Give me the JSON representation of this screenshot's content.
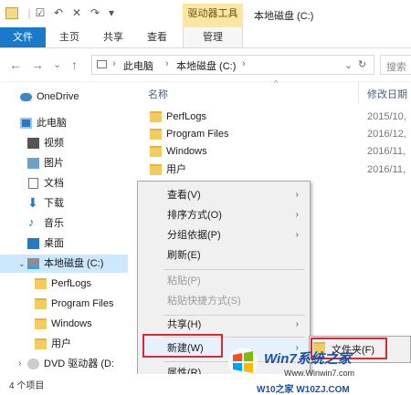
{
  "window": {
    "title": "本地磁盘 (C:)",
    "drive_tools_tab": "驱动器工具",
    "qat_dropdown": "▾"
  },
  "ribbon": {
    "tabs": [
      "文件",
      "主页",
      "共享",
      "查看",
      "管理"
    ]
  },
  "nav": {
    "back": "←",
    "forward": "→",
    "recent": "⌄",
    "up": "↑",
    "path": [
      "此电脑",
      "本地磁盘 (C:)"
    ],
    "separator": "›",
    "refresh": "↻",
    "search_placeholder": "搜索"
  },
  "sidebar": {
    "items": [
      {
        "label": "OneDrive",
        "icon": "cloud-icon"
      },
      {
        "label": "此电脑",
        "icon": "computer-icon"
      },
      {
        "label": "视频",
        "icon": "video-folder-icon"
      },
      {
        "label": "图片",
        "icon": "pictures-folder-icon"
      },
      {
        "label": "文档",
        "icon": "documents-folder-icon"
      },
      {
        "label": "下载",
        "icon": "download-folder-icon"
      },
      {
        "label": "音乐",
        "icon": "music-folder-icon"
      },
      {
        "label": "桌面",
        "icon": "desktop-folder-icon"
      },
      {
        "label": "本地磁盘 (C:)",
        "icon": "drive-icon"
      },
      {
        "label": "PerfLogs",
        "icon": "folder-icon"
      },
      {
        "label": "Program Files",
        "icon": "folder-icon"
      },
      {
        "label": "Windows",
        "icon": "folder-icon"
      },
      {
        "label": "用户",
        "icon": "folder-icon"
      },
      {
        "label": "DVD 驱动器 (D:",
        "icon": "dvd-drive-icon"
      }
    ]
  },
  "columns": {
    "name": "名称",
    "date": "修改日期"
  },
  "files": [
    {
      "name": "PerfLogs",
      "date": "2015/10,"
    },
    {
      "name": "Program Files",
      "date": "2016/12,"
    },
    {
      "name": "Windows",
      "date": "2016/11,"
    },
    {
      "name": "用户",
      "date": "2016/11,"
    }
  ],
  "context_menu": {
    "view": "查看(V)",
    "sort": "排序方式(O)",
    "group": "分组依据(P)",
    "refresh": "刷新(E)",
    "paste": "粘贴(P)",
    "paste_shortcut": "粘贴快捷方式(S)",
    "share": "共享(H)",
    "new": "新建(W)",
    "properties": "属性(R)",
    "submenu_arrow": "›"
  },
  "submenu": {
    "folder": "文件夹(F)"
  },
  "status": {
    "item_count": "4 个项目"
  },
  "watermark": {
    "line1": "Win7系统之家",
    "line2": "Www.Winwin7.com",
    "line3": "W10之家 W10ZJ.COM"
  },
  "colors": {
    "accent": "#1979ca",
    "drive_tools": "#fbe7a1",
    "selection": "#cce8ff",
    "highlight_box": "#e0262e"
  }
}
